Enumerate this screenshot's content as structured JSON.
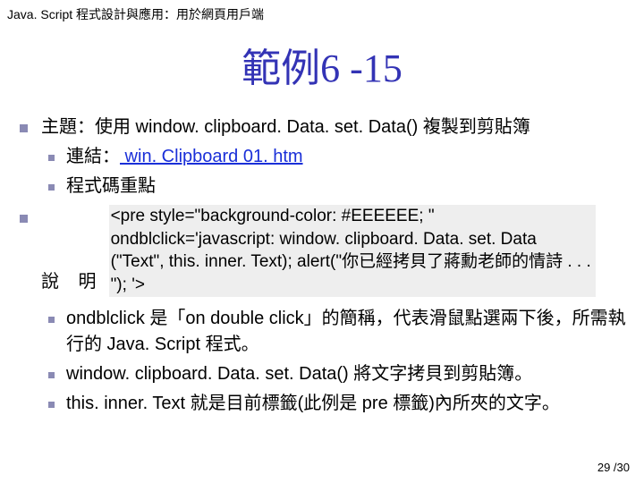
{
  "header": "Java. Script 程式設計與應用：用於網頁用戶端",
  "title": "範例6 -15",
  "topic_label": "主題：使用 window. clipboard. Data. set. Data() 複製到剪貼簿",
  "link_prefix": "連結：",
  "link_text": " win. Clipboard 01. htm",
  "code_heading": "程式碼重點",
  "desc_label": "說 明",
  "code": "<pre style=\"background-color: #EEEEEE; \" ondblclick='javascript: window. clipboard. Data. set. Data (\"Text\", this. inner. Text); alert(\"你已經拷貝了蔣勳老師的情詩 . . . \"); '>",
  "points": [
    "ondblclick 是「on double click」的簡稱，代表滑鼠點選兩下後，所需執行的 Java. Script 程式。",
    "window. clipboard. Data. set. Data() 將文字拷貝到剪貼簿。",
    "this. inner. Text 就是目前標籤(此例是 pre 標籤)內所夾的文字。"
  ],
  "page": "29 /30"
}
